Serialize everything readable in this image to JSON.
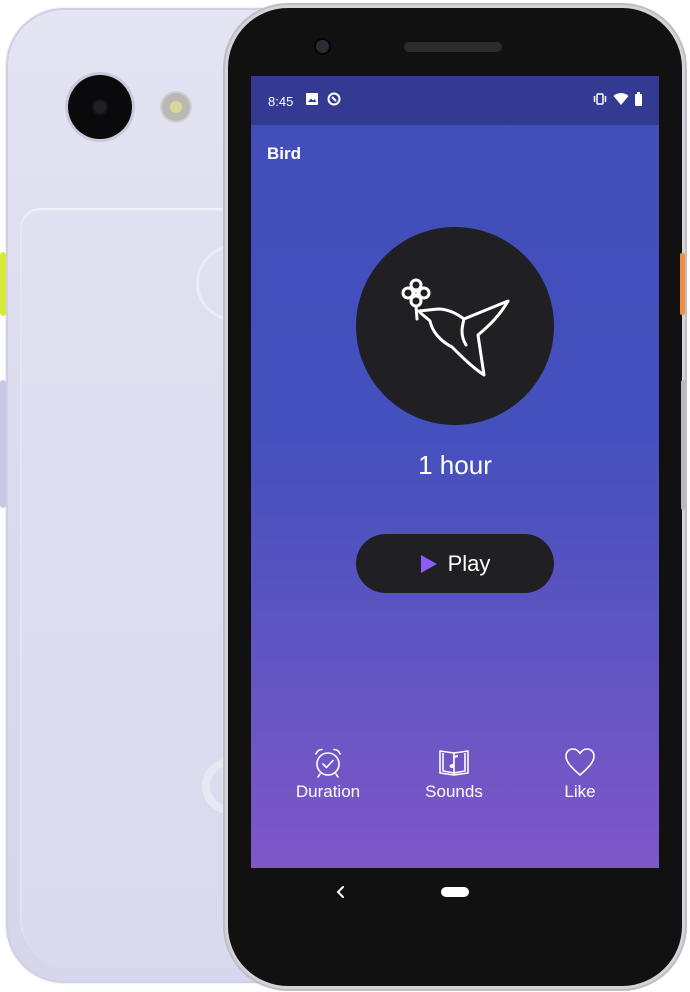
{
  "device": {
    "colors": {
      "back_body": "#dcdcef",
      "power_button": "#f28c43",
      "side_button_green": "#d6ea3a"
    }
  },
  "status_bar": {
    "time": "8:45",
    "left_icons": [
      "image-icon",
      "sync-icon"
    ],
    "right_icons": [
      "vibrate-icon",
      "wifi-icon",
      "battery-icon"
    ],
    "background": "#343a92"
  },
  "app": {
    "title": "Bird",
    "background_top": "#414eb9",
    "background_bottom": "#7f57c9",
    "illustration_icon": "hummingbird-icon",
    "duration": "1 hour",
    "play": {
      "label": "Play",
      "icon": "play-icon",
      "icon_color": "#8b5cf6"
    },
    "bottom_nav": [
      {
        "label": "Duration",
        "icon": "alarm-clock-icon"
      },
      {
        "label": "Sounds",
        "icon": "music-book-icon"
      },
      {
        "label": "Like",
        "icon": "heart-icon"
      }
    ]
  },
  "system_nav": {
    "back": "back-chevron-icon",
    "home": "home-pill-icon"
  }
}
